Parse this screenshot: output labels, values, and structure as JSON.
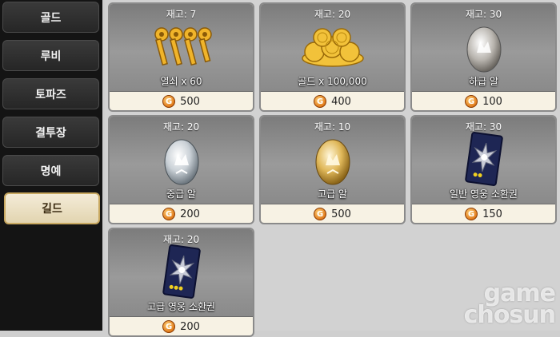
{
  "sidebar": {
    "tabs": [
      {
        "label": "골드"
      },
      {
        "label": "루비"
      },
      {
        "label": "토파즈"
      },
      {
        "label": "결투장"
      },
      {
        "label": "명예"
      },
      {
        "label": "길드",
        "active": true
      }
    ]
  },
  "shop": {
    "items": [
      {
        "stock": "재고: 7",
        "name": "열쇠 x 60",
        "price": "500",
        "icon": "keys-icon"
      },
      {
        "stock": "재고: 20",
        "name": "골드 x 100,000",
        "price": "400",
        "icon": "gold-coins-icon"
      },
      {
        "stock": "재고: 30",
        "name": "하급 알",
        "price": "100",
        "icon": "low-egg-icon"
      },
      {
        "stock": "재고: 20",
        "name": "중급 알",
        "price": "200",
        "icon": "mid-egg-icon"
      },
      {
        "stock": "재고: 10",
        "name": "고급 알",
        "price": "500",
        "icon": "high-egg-icon"
      },
      {
        "stock": "재고: 30",
        "name": "일반 영웅 소환권",
        "price": "150",
        "icon": "hero-ticket-icon"
      },
      {
        "stock": "재고: 20",
        "name": "고급 영웅 소환권",
        "price": "200",
        "icon": "premium-hero-ticket-icon"
      }
    ],
    "currency_icon_letter": "G"
  },
  "watermark": {
    "line1": "game",
    "line2": "chosun"
  },
  "colors": {
    "active_tab_border": "#c8a860",
    "card_border": "#8a8a8a",
    "price_bg": "#f7f2e4",
    "coin": "#e07a1a"
  }
}
